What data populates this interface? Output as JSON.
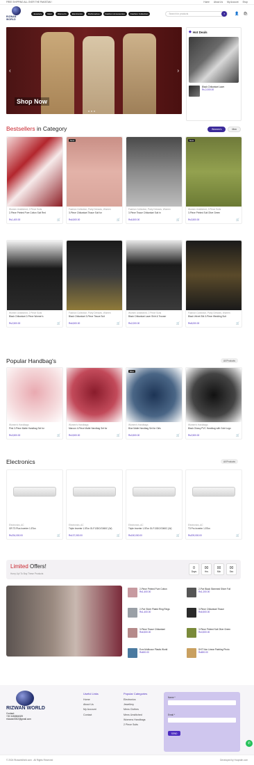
{
  "topbar": {
    "promo": "FREE SHIPPING ALL OVER THE PAKISTAN !",
    "links": [
      "Home",
      "About Us",
      "My Account",
      "Shop"
    ]
  },
  "header": {
    "logo_text": "RIZWAN WORLD",
    "nav": [
      "Jewelery",
      "Meni",
      "Women's",
      "Electronics",
      "Perfumeries",
      "Fashion Accessories",
      "Fashion Collection"
    ],
    "search_placeholder": "Search for products"
  },
  "hero": {
    "cta": "Shop Now"
  },
  "hot_deals": {
    "title": "Hot Deals",
    "item_name": "Black Chikankari Lawn",
    "item_price": "Rs.2,000.00"
  },
  "bestsellers": {
    "title_accent": "Bestsellers",
    "title_rest": " in Category",
    "tabs": [
      "Women's",
      "Men"
    ],
    "products": [
      {
        "cat": "Women Unstitched, 2 Piece Suits",
        "name": "2-Piece Printed Pure Cotton Suit Red",
        "price": "Rs1,400.00",
        "badge": ""
      },
      {
        "cat": "Fashion Collection, Party Dresses, Women",
        "name": "3-Piece Chikankari Tissue Suit for",
        "price": "Rs6,500.00",
        "badge": "New"
      },
      {
        "cat": "Fashion Collection, Party Dresses, Women",
        "name": "3-Piece Tissue Chikankari Suit in",
        "price": "Rs6,500.00",
        "badge": ""
      },
      {
        "cat": "Women Unstitched, 3 Piece Suits",
        "name": "3-Piece Printed Suit Olive Green",
        "price": "Rs3,500.00",
        "badge": "New"
      },
      {
        "cat": "Women Unstitched, 2 Piece Suits",
        "name": "Black Chikankari 2-Piece Women's",
        "price": "Rs2,500.00",
        "badge": ""
      },
      {
        "cat": "Fashion Collection, Party Dresses, Women",
        "name": "Black Chikankari 3-Piece Tissue Suit",
        "price": "Rs6,500.00",
        "badge": ""
      },
      {
        "cat": "Women Unstitched, 2 Piece Suits",
        "name": "Black Chikankari Lawn Shirt & Trouser",
        "price": "Rs2,000.00",
        "badge": ""
      },
      {
        "cat": "Fashion Collection, Party Dresses, Women",
        "name": "Black Velvet Silk 3-Piece Wedding Suit",
        "price": "Rs8,000.00",
        "badge": ""
      }
    ]
  },
  "handbags": {
    "title": "Popular Handbag's",
    "view_all": "All Products",
    "products": [
      {
        "cat": "Women's Handbags",
        "name": "Pink 3-Piece Matte Handbag Set for",
        "price": "Rs3,500.00",
        "badge": ""
      },
      {
        "cat": "Women's Handbags",
        "name": "Maroon 4-Piece Matte Handbag Set for",
        "price": "Rs3,500.00",
        "badge": ""
      },
      {
        "cat": "Women's Handbags",
        "name": "Blue Matte Handbag Set for Girls",
        "price": "Rs3,500.00",
        "badge": "Blue"
      },
      {
        "cat": "Women's Handbags",
        "name": "Black Glossy PVC Handbag with Gold Logo",
        "price": "Rs2,500.00",
        "badge": ""
      }
    ]
  },
  "electronics": {
    "title": "Electronics",
    "view_all": "All Products",
    "products": [
      {
        "cat": "Electronics, AC",
        "name": "GR T3 Plus Inverter 1.5Ton",
        "price": "Rs234,000.00"
      },
      {
        "cat": "Electronics, AC",
        "name": "Triple Inverter 1.5Ton GI-F13DC/G060C (W)",
        "price": "Rs137,000.00"
      },
      {
        "cat": "Electronics, AC",
        "name": "Triple Inverter 1.5Ton GI-F13DC/G060C (W)",
        "price": "Rs150,000.00"
      },
      {
        "cat": "Electronics, AC",
        "name": "T3 Pro Inverter 1.5Ton",
        "price": "Rs209,000.00"
      }
    ]
  },
  "limited": {
    "title_accent": "Limited",
    "title_rest": " Offers!",
    "subtitle": "Hurry Up! To Buy These Products",
    "timer": [
      {
        "num": "0",
        "label": "Days"
      },
      {
        "num": "00",
        "label": "Hrs"
      },
      {
        "num": "00",
        "label": "Min"
      },
      {
        "num": "00",
        "label": "Sec"
      }
    ],
    "items": [
      {
        "name": "2-Piece Printed Pure Cotton",
        "price": "Rs1,400.00"
      },
      {
        "name": "2-Pce Silver Plated Ring Rings",
        "price": "Rs1,400.00"
      },
      {
        "name": "3-Piece Tissue Chikankari",
        "price": "Rs6,500.00"
      },
      {
        "name": "Ecm Multicoun Plastic World",
        "price": "Rs600.00"
      },
      {
        "name": "2-Pce Black Skimmed Silver Full",
        "price": "Rs1,200.00"
      },
      {
        "name": "3-Piece Chikankari Tissue",
        "price": "Rs6,500.00"
      },
      {
        "name": "3-Piece Printed Suit Olive Green",
        "price": "Rs3,500.00"
      },
      {
        "name": "DHT Non Linear Painting Photo",
        "price": "Rs800.00"
      }
    ]
  },
  "footer": {
    "logo_text": "RIZWAN WORLD",
    "contact_label": "Contact:",
    "phone": "+92 3452866329",
    "email": "rhizwan0002@gmail.com",
    "useful_title": "Useful Links",
    "useful": [
      "Home",
      "About Us",
      "My Account",
      "Contact"
    ],
    "popular_title": "Popular Categories",
    "popular": [
      "Electronics",
      "Jewellery",
      "Mens Clothes",
      "Mens Unstitched",
      "Womens Handbags",
      "2 Piece Suits"
    ],
    "form_name": "Name *",
    "form_email": "Email *",
    "form_send": "SEND",
    "copyright": "© 2024 RizwanWorld.com . All Rights Reserved",
    "developed": "Developed by Hoopsite.com"
  },
  "colors": {
    "accent": "#4b2bbf",
    "red": "#c8232c"
  }
}
